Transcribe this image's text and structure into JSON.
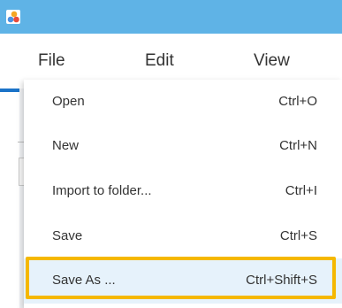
{
  "window": {
    "app_icon": "app-logo-icon"
  },
  "menubar": {
    "items": [
      {
        "label": "File"
      },
      {
        "label": "Edit"
      },
      {
        "label": "View"
      }
    ]
  },
  "file_menu": {
    "items": [
      {
        "label": "Open",
        "shortcut": "Ctrl+O"
      },
      {
        "label": "New",
        "shortcut": "Ctrl+N"
      },
      {
        "label": "Import to folder...",
        "shortcut": "Ctrl+I"
      },
      {
        "label": "Save",
        "shortcut": "Ctrl+S"
      },
      {
        "label": "Save As ...",
        "shortcut": "Ctrl+Shift+S"
      }
    ],
    "highlighted_item": "Save As ...",
    "highlight_color": "#f5b800",
    "hover_color": "#e6f2fb"
  },
  "colors": {
    "titlebar": "#5fb3e6",
    "accent": "#1b73c8"
  }
}
